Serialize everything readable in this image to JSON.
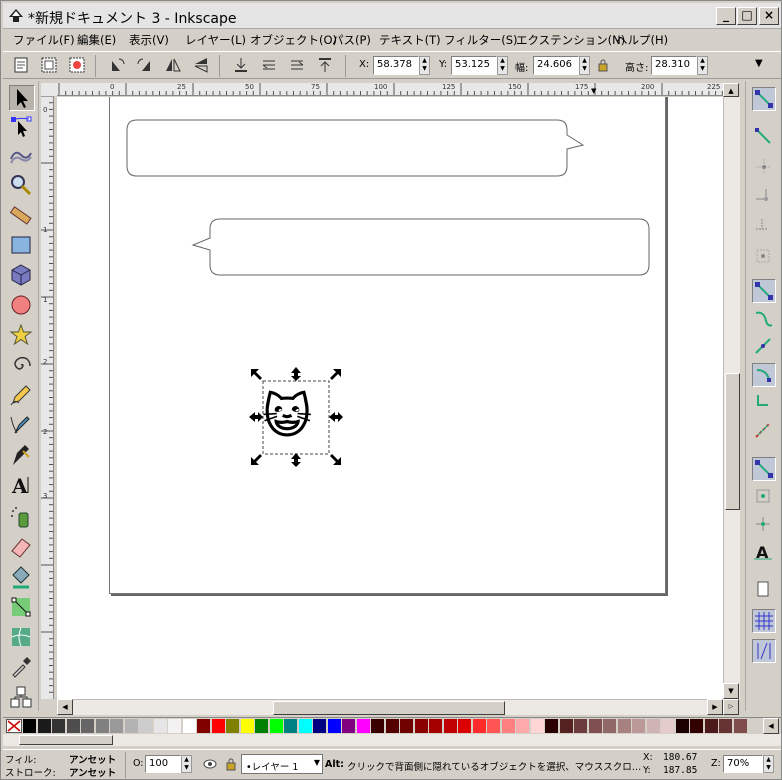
{
  "window": {
    "title": "*新規ドキュメント 3 - Inkscape",
    "minimize": "_",
    "maximize": "□",
    "close": "×"
  },
  "menu": [
    "ファイル(F)",
    "編集(E)",
    "表示(V)",
    "レイヤー(L)",
    "オブジェクト(O)",
    "パス(P)",
    "テキスト(T)",
    "フィルター(S)",
    "エクステンション(N)",
    "ヘルプ(H)"
  ],
  "toolbar": {
    "x_label": "X:",
    "x_value": "58.378",
    "y_label": "Y:",
    "y_value": "53.125",
    "w_label": "幅:",
    "w_value": "24.606",
    "h_label": "高さ:",
    "h_value": "28.310"
  },
  "ruler": {
    "h_ticks": [
      "0",
      "25",
      "50",
      "75",
      "100",
      "125",
      "150",
      "175",
      "200",
      "225"
    ],
    "v_ticks": [
      "0",
      "1",
      "1",
      "2",
      "2",
      "3"
    ]
  },
  "canvas": {
    "selected_object": "😺"
  },
  "colors": {
    "palette": [
      "#000000",
      "#1a1a1a",
      "#333333",
      "#4d4d4d",
      "#666666",
      "#808080",
      "#999999",
      "#b3b3b3",
      "#cccccc",
      "#e6e6e6",
      "#f2f2f2",
      "#ffffff",
      "#800000",
      "#ff0000",
      "#808000",
      "#ffff00",
      "#008000",
      "#00ff00",
      "#008080",
      "#00ffff",
      "#000080",
      "#0000ff",
      "#800080",
      "#ff00ff",
      "#3a0000",
      "#550000",
      "#6e0000",
      "#8a0000",
      "#a40000",
      "#c00000",
      "#dd0000",
      "#ff2a2a",
      "#ff5555",
      "#ff8080",
      "#ffaaaa",
      "#ffd5d5",
      "#2b0000",
      "#552222",
      "#6c3c3c",
      "#805050",
      "#916868",
      "#a78080",
      "#bb9999",
      "#d0b3b3",
      "#e4cccc",
      "#1a0000",
      "#330000",
      "#4d1a1a",
      "#663333",
      "#804d4d"
    ]
  },
  "status": {
    "fill_label": "フィル:",
    "fill_value": "アンセット",
    "stroke_label": "ストローク:",
    "stroke_value": "アンセット",
    "opacity_label": "O:",
    "opacity_value": "100",
    "layer_value": "•レイヤー 1",
    "message_key": "Alt:",
    "message": "クリックで背面側に隠れているオブジェクトを選択、マウススクロ…",
    "x_label": "X:",
    "x_value": "180.67",
    "y_label": "Y:",
    "y_value": "187.85",
    "zoom_label": "Z:",
    "zoom_value": "70%"
  }
}
